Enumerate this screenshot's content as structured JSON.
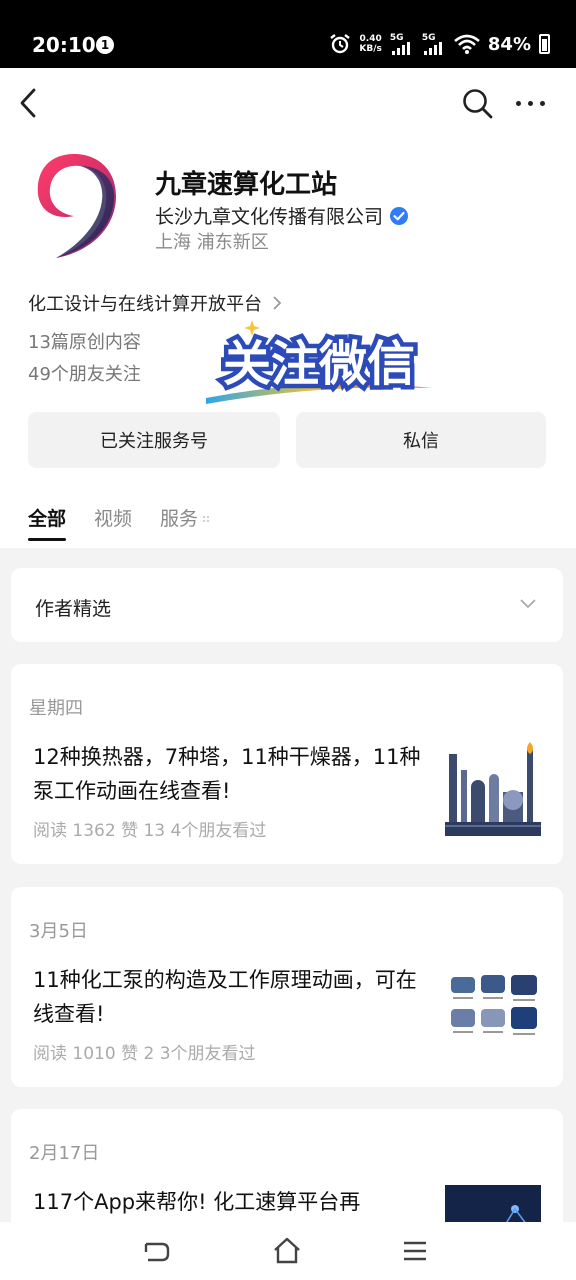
{
  "status": {
    "time": "20:10",
    "notification_badge": "1",
    "net_speed_value": "0.40",
    "net_speed_unit": "KB/s",
    "network_1": "5G",
    "network_2": "5G",
    "battery": "84%"
  },
  "profile": {
    "name": "九章速算化工站",
    "company": "长沙九章文化传播有限公司",
    "location": "上海 浦东新区",
    "description": "化工设计与在线计算开放平台",
    "originals": "13篇原创内容",
    "followers": "49个朋友关注",
    "sticker_text": "关注微信"
  },
  "actions": {
    "follow": "已关注服务号",
    "message": "私信"
  },
  "tabs": [
    "全部",
    "视频",
    "服务"
  ],
  "picks": {
    "label": "作者精选"
  },
  "articles": [
    {
      "date": "星期四",
      "title": "12种换热器，7种塔，11种干燥器，11种泵工作动画在线查看!",
      "meta": "阅读 1362  赞 13  4个朋友看过"
    },
    {
      "date": "3月5日",
      "title": "11种化工泵的构造及工作原理动画，可在线查看!",
      "meta": "阅读 1010  赞 2  3个朋友看过"
    },
    {
      "date": "2月17日",
      "title": "117个App来帮你! 化工速算平台再",
      "meta": ""
    }
  ],
  "colors": {
    "verified_blue": "#2f7cf6",
    "logo_red": "#e0325a",
    "logo_navy": "#1c2848"
  }
}
